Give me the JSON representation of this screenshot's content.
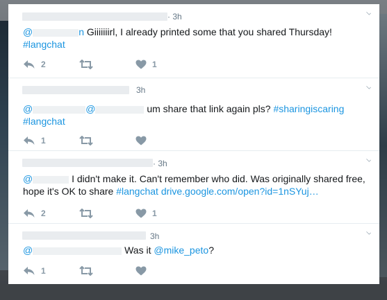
{
  "tweets": [
    {
      "time": "· 3h",
      "at": "@",
      "mention_tail": "n",
      "text": "Giiiiiiirl, I already printed some that you shared Thursday!",
      "hashtag_line2": "#langchat",
      "reply_count": "2",
      "like_count": "1"
    },
    {
      "time": "3h",
      "at1": "@",
      "at2": "@",
      "text": "um share that link again pls?",
      "hashtag1": "#sharingiscaring",
      "hashtag2": "#langchat"
    },
    {
      "time": "· 3h",
      "at": "@",
      "text_line1": "I didn't make it. Can't remember who did. Was originally shared free,",
      "text_line2_prefix": "hope it's OK to share",
      "hashtag": "#langchat",
      "link": "drive.google.com/open?id=1nSYuj…",
      "reply_count": "2",
      "like_count": "1"
    },
    {
      "time": "3h",
      "at": "@",
      "text_prefix": "Was it",
      "mention": "@mike_peto",
      "text_suffix": "?",
      "reply_count": "1"
    }
  ],
  "icons": {
    "reply": "reply-icon",
    "retweet": "retweet-icon",
    "like": "heart-icon",
    "caret": "chevron-down-icon"
  },
  "colors": {
    "link": "#1b95e0",
    "action_gray": "#8899a6",
    "text": "#14171a"
  }
}
